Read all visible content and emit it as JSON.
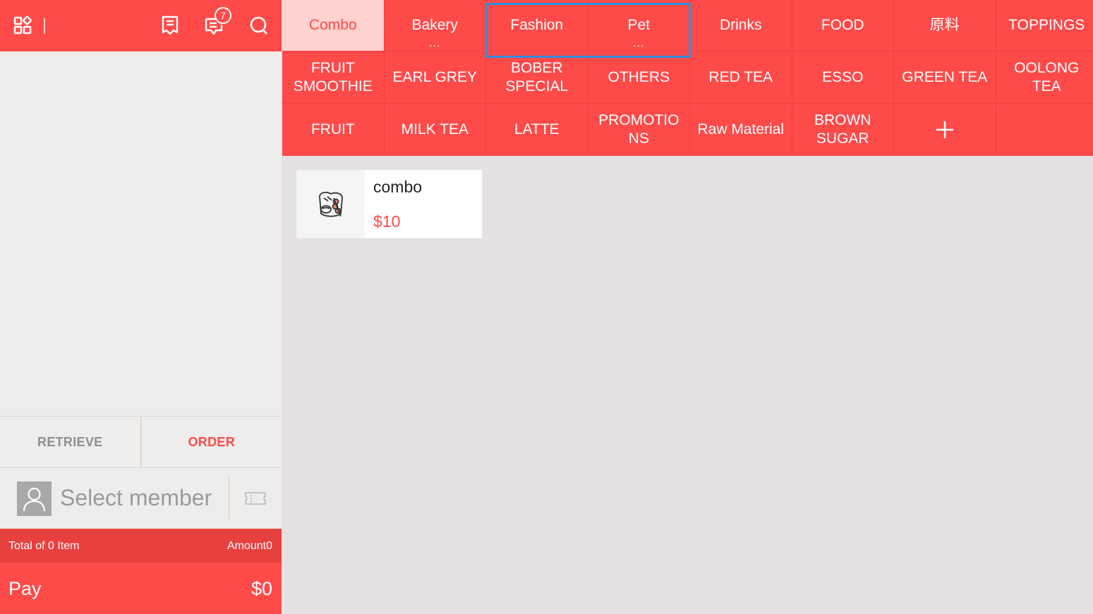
{
  "header": {
    "badge_count": "7",
    "icons": [
      "apps-grid-icon",
      "receipt-icon",
      "chat-message-icon",
      "search-icon"
    ]
  },
  "actions": {
    "retrieve_label": "RETRIEVE",
    "order_label": "ORDER"
  },
  "member": {
    "placeholder": "Select member"
  },
  "totals": {
    "items_label": "Total of 0 Item",
    "amount_label": "Amount0"
  },
  "pay": {
    "label": "Pay",
    "amount": "$0"
  },
  "categories": {
    "row1": [
      {
        "label": "Combo",
        "active": true
      },
      {
        "label": "Bakery",
        "more": "..."
      },
      {
        "label": "Fashion"
      },
      {
        "label": "Pet",
        "more": "..."
      },
      {
        "label": "Drinks"
      },
      {
        "label": "FOOD"
      },
      {
        "label": "原料"
      },
      {
        "label": "TOPPINGS"
      }
    ],
    "row2": [
      {
        "label": "FRUIT SMOOTHIE"
      },
      {
        "label": "EARL GREY"
      },
      {
        "label": "BOBER SPECIAL"
      },
      {
        "label": "OTHERS"
      },
      {
        "label": "RED TEA"
      },
      {
        "label": "ESSO"
      },
      {
        "label": "GREEN TEA"
      },
      {
        "label": "OOLONG TEA"
      }
    ],
    "row3": [
      {
        "label": "FRUIT"
      },
      {
        "label": "MILK TEA"
      },
      {
        "label": "LATTE"
      },
      {
        "label": "PROMOTIONS"
      },
      {
        "label": "Raw Material"
      },
      {
        "label": "BROWN SUGAR"
      }
    ]
  },
  "products": [
    {
      "name": "combo",
      "price": "$10",
      "icon": "combo-food-icon"
    }
  ],
  "colors": {
    "accent": "#ff4a4a",
    "active_tab_bg": "#ffd1cf",
    "selection_outline": "#2f8fe0"
  }
}
